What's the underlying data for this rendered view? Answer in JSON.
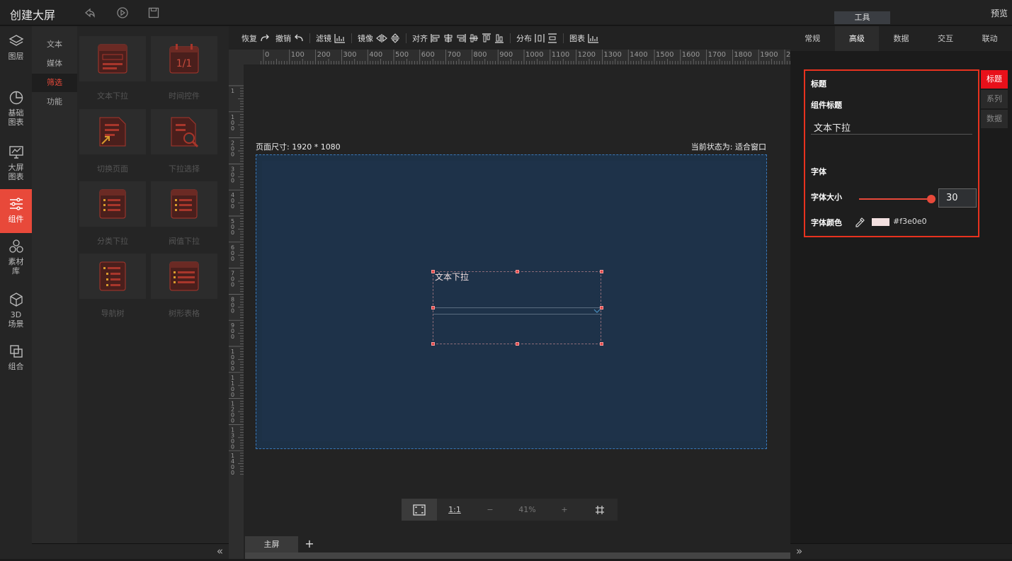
{
  "header": {
    "title": "创建大屏",
    "tool_tab": "工具",
    "preview": "预览"
  },
  "leftnav": [
    {
      "label": "图层",
      "icon": "layers-icon"
    },
    {
      "label": "基础图表",
      "icon": "pie-chart-icon"
    },
    {
      "label": "大屏图表",
      "icon": "monitor-chart-icon"
    },
    {
      "label": "组件",
      "icon": "sliders-icon",
      "active": true
    },
    {
      "label": "素材库",
      "icon": "hexagons-icon"
    },
    {
      "label": "3D场景",
      "icon": "cube-icon"
    },
    {
      "label": "组合",
      "icon": "combine-icon"
    }
  ],
  "subnav": [
    {
      "label": "文本"
    },
    {
      "label": "媒体"
    },
    {
      "label": "筛选",
      "active": true
    },
    {
      "label": "功能"
    }
  ],
  "gallery": [
    {
      "label": "文本下拉",
      "icon": "text-dropdown-icon"
    },
    {
      "label": "时间控件",
      "icon": "calendar-icon"
    },
    {
      "label": "切换页面",
      "icon": "switch-page-icon"
    },
    {
      "label": "下拉选择",
      "icon": "search-doc-icon"
    },
    {
      "label": "分类下拉",
      "icon": "list-dropdown-icon"
    },
    {
      "label": "阀值下拉",
      "icon": "list-dropdown-icon"
    },
    {
      "label": "导航树",
      "icon": "tree-icon"
    },
    {
      "label": "树形表格",
      "icon": "tree-table-icon"
    }
  ],
  "toolbar": {
    "redo": "恢复",
    "undo": "撤销",
    "filter": "滤镜",
    "mirror": "镜像",
    "align": "对齐",
    "distribute": "分布",
    "chart": "图表"
  },
  "canvas": {
    "page_size": "页面尺寸: 1920 * 1080",
    "status": "当前状态为: 适合窗口",
    "widget_title": "文本下拉",
    "ruler_top": [
      "0",
      "100",
      "200",
      "300",
      "400",
      "500",
      "600",
      "700",
      "800",
      "900",
      "1000",
      "1100",
      "1200",
      "1300",
      "1400",
      "1500",
      "1600",
      "1700",
      "1800",
      "1900",
      "200"
    ],
    "ruler_left": [
      "1",
      "1 0 0",
      "2 0 0",
      "3 0 0",
      "4 0 0",
      "5 0 0",
      "6 0 0",
      "7 0 0",
      "8 0 0",
      "9 0 0",
      "1 0 0 0",
      "1 1 0 0",
      "1 2 0 0",
      "1 3 0 0",
      "1 4 0 0"
    ],
    "zoom": "41%",
    "ratio": "1:1",
    "minus": "−",
    "plus": "+",
    "screen_tab": "主屏",
    "add_tab": "+"
  },
  "right": {
    "tabs": [
      {
        "label": "常规"
      },
      {
        "label": "高级",
        "active": true
      },
      {
        "label": "数据"
      },
      {
        "label": "交互"
      },
      {
        "label": "联动"
      }
    ],
    "section_title": "标题",
    "component_title_label": "组件标题",
    "component_title_value": "文本下拉",
    "font_section": "字体",
    "font_size_label": "字体大小",
    "font_size_value": "30",
    "font_size_fraction": 0.95,
    "font_color_label": "字体颜色",
    "font_color_value": "#f3e0e0",
    "side_tabs": [
      {
        "label": "标题",
        "active": true
      },
      {
        "label": "系列"
      },
      {
        "label": "数据"
      }
    ]
  },
  "colors": {
    "accent": "#e8493a",
    "panel_border": "#e8321f",
    "screen_bg": "#1d3146",
    "selection": "#3a78b8"
  }
}
